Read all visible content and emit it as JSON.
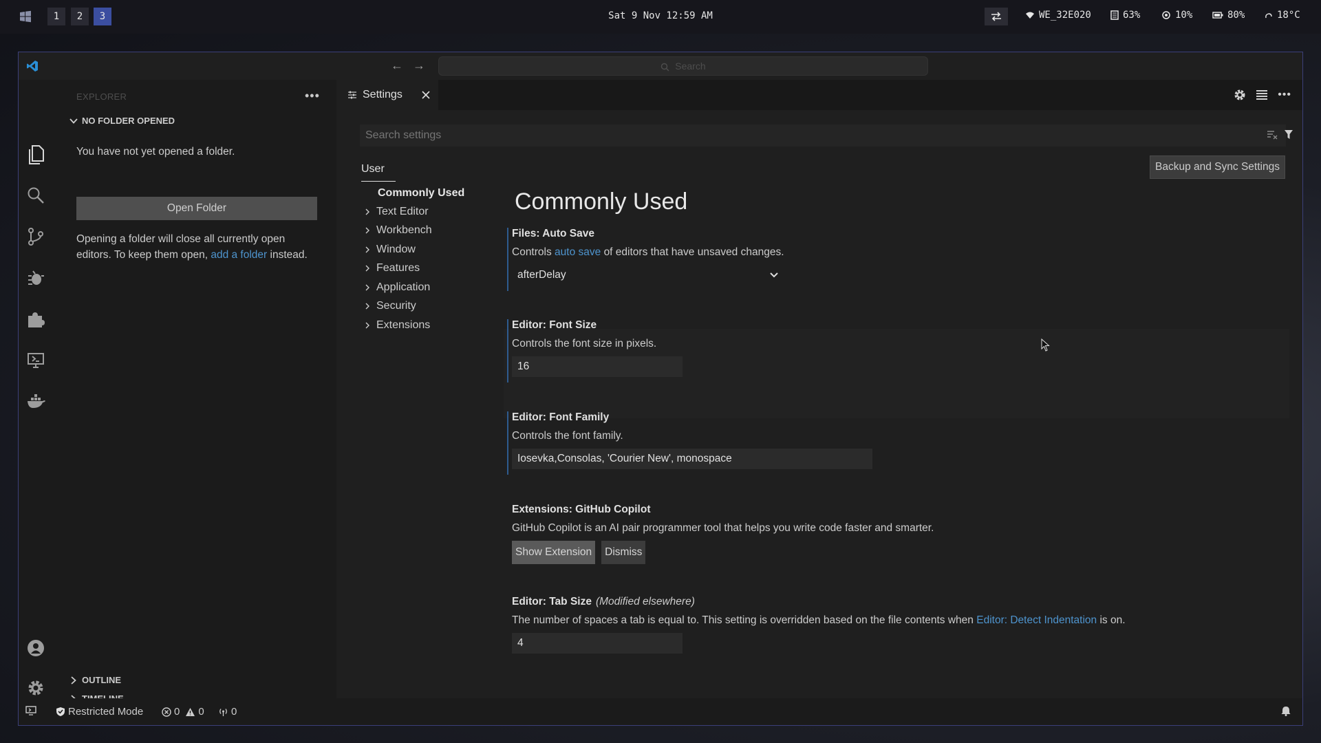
{
  "taskbar": {
    "workspaces": [
      "1",
      "2",
      "3"
    ],
    "active_workspace": "3",
    "clock": "Sat 9 Nov 12:59 AM",
    "wifi": "WE_32E020",
    "cpu": "63%",
    "memory": "10%",
    "battery": "80%",
    "temperature": "18°C"
  },
  "window": {
    "command_search_placeholder": "Search"
  },
  "sidebar": {
    "title": "EXPLORER",
    "section_title": "NO FOLDER OPENED",
    "no_folder_text": "You have not yet opened a folder.",
    "open_folder_button": "Open Folder",
    "hint_before": "Opening a folder will close all currently open editors. To keep them open,",
    "hint_link": "add a folder",
    "hint_after": "instead.",
    "outline": "OUTLINE",
    "timeline": "TIMELINE"
  },
  "editor": {
    "tab_label": "Settings",
    "search_placeholder": "Search settings",
    "scope_tab": "User",
    "backup_button": "Backup and Sync Settings",
    "toc": [
      "Commonly Used",
      "Text Editor",
      "Workbench",
      "Window",
      "Features",
      "Application",
      "Security",
      "Extensions"
    ],
    "heading": "Commonly Used",
    "settings": {
      "auto_save": {
        "title": "Files: Auto Save",
        "desc_before": "Controls",
        "desc_link": "auto save",
        "desc_after": "of editors that have unsaved changes.",
        "value": "afterDelay"
      },
      "font_size": {
        "title": "Editor: Font Size",
        "desc": "Controls the font size in pixels.",
        "value": "16"
      },
      "font_family": {
        "title": "Editor: Font Family",
        "desc": "Controls the font family.",
        "value": "Iosevka,Consolas, 'Courier New', monospace"
      },
      "copilot": {
        "title": "Extensions: GitHub Copilot",
        "desc": "GitHub Copilot is an AI pair programmer tool that helps you write code faster and smarter.",
        "show_button": "Show Extension",
        "dismiss_button": "Dismiss"
      },
      "tab_size": {
        "title": "Editor: Tab Size",
        "modified": "(Modified elsewhere)",
        "desc_before": "The number of spaces a tab is equal to. This setting is overridden based on the file contents when",
        "desc_link": "Editor: Detect Indentation",
        "desc_after": "is on.",
        "value": "4"
      }
    }
  },
  "statusbar": {
    "restricted_mode": "Restricted Mode",
    "errors": "0",
    "warnings": "0",
    "ports": "0"
  },
  "colors": {
    "accent": "#3b4ea0",
    "link": "#4e94ce",
    "vscode_blue": "#2a8fd6"
  }
}
